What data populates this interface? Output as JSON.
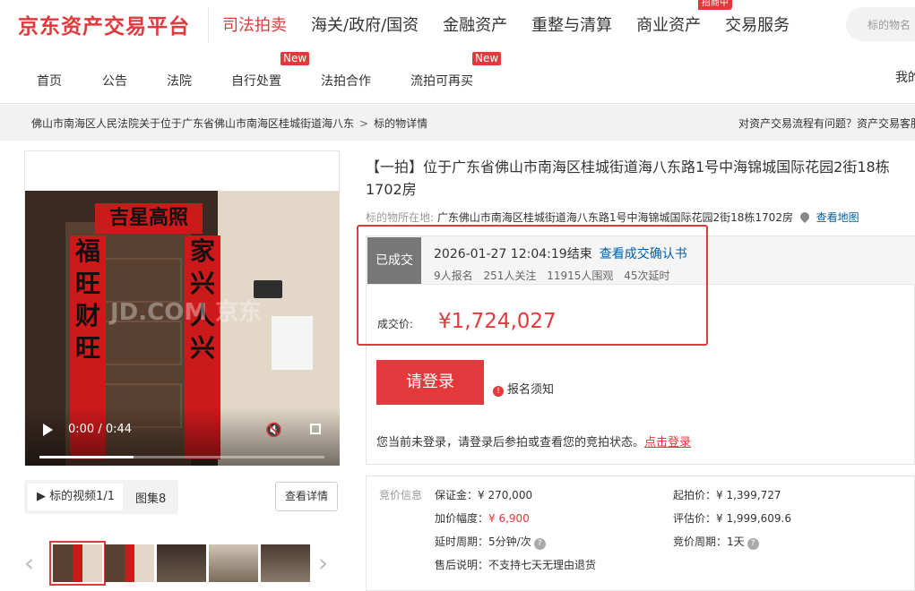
{
  "header": {
    "logo": "京东资产交易平台",
    "nav": [
      "司法拍卖",
      "海关/政府/国资",
      "金融资产",
      "重整与清算",
      "商业资产",
      "交易服务"
    ],
    "hot_badge": "招商中",
    "search_placeholder": "标的物名"
  },
  "subnav": {
    "items": [
      "首页",
      "公告",
      "法院",
      "自行处置",
      "法拍合作",
      "流拍可再买"
    ],
    "new_badge": "New",
    "mine": "我的"
  },
  "breadcrumb": {
    "path": "佛山市南海区人民法院关于位于广东省佛山市南海区桂城街道海八东",
    "current": "标的物详情",
    "help": "对资产交易流程有问题？资产交易客服"
  },
  "media": {
    "watermark": "JD.COM 京东",
    "time": "0:00 / 0:44",
    "progress": 0.33,
    "tab_video": "▶ 标的视频1/1",
    "tab_gallery": "图集8",
    "detail_button": "查看详情",
    "prev": "‹",
    "next": "›"
  },
  "item": {
    "title": "【一拍】位于广东省佛山市南海区桂城街道海八东路1号中海锦城国际花园2街18栋1702房",
    "location_label": "标的物所在地:",
    "location": "广东佛山市南海区桂城街道海八东路1号中海锦城国际花园2街18栋1702房",
    "map_link": "查看地图"
  },
  "status": {
    "tag": "已成交",
    "end_time": "2026-01-27 12:04:19结束",
    "confirm_link": "查看成交确认书",
    "signups": "9人报名",
    "followers": "251人关注",
    "viewers": "11915人围观",
    "delays": "45次延时",
    "price_label": "成交价:",
    "price": "¥1,724,027"
  },
  "actions": {
    "login_button": "请登录",
    "signup_notice": "报名须知",
    "login_tip": "您当前未登录，请登录后参拍或查看您的竞拍状态。",
    "login_link": "点击登录"
  },
  "bid_info": {
    "title": "竞价信息",
    "deposit_label": "保证金：",
    "deposit": "¥ 270,000",
    "increment_label": "加价幅度：",
    "increment": "¥ 6,900",
    "delay_label": "延时周期：",
    "delay": "5分钟/次",
    "after_sale_label": "售后说明：",
    "after_sale": "不支持七天无理由退货",
    "start_price_label": "起拍价：",
    "start_price": "¥ 1,399,727",
    "appraisal_label": "评估价：",
    "appraisal": "¥ 1,999,609.6",
    "cycle_label": "竞价周期：",
    "cycle": "1天"
  },
  "colors": {
    "accent": "#e4393c",
    "link": "#005ea7"
  }
}
